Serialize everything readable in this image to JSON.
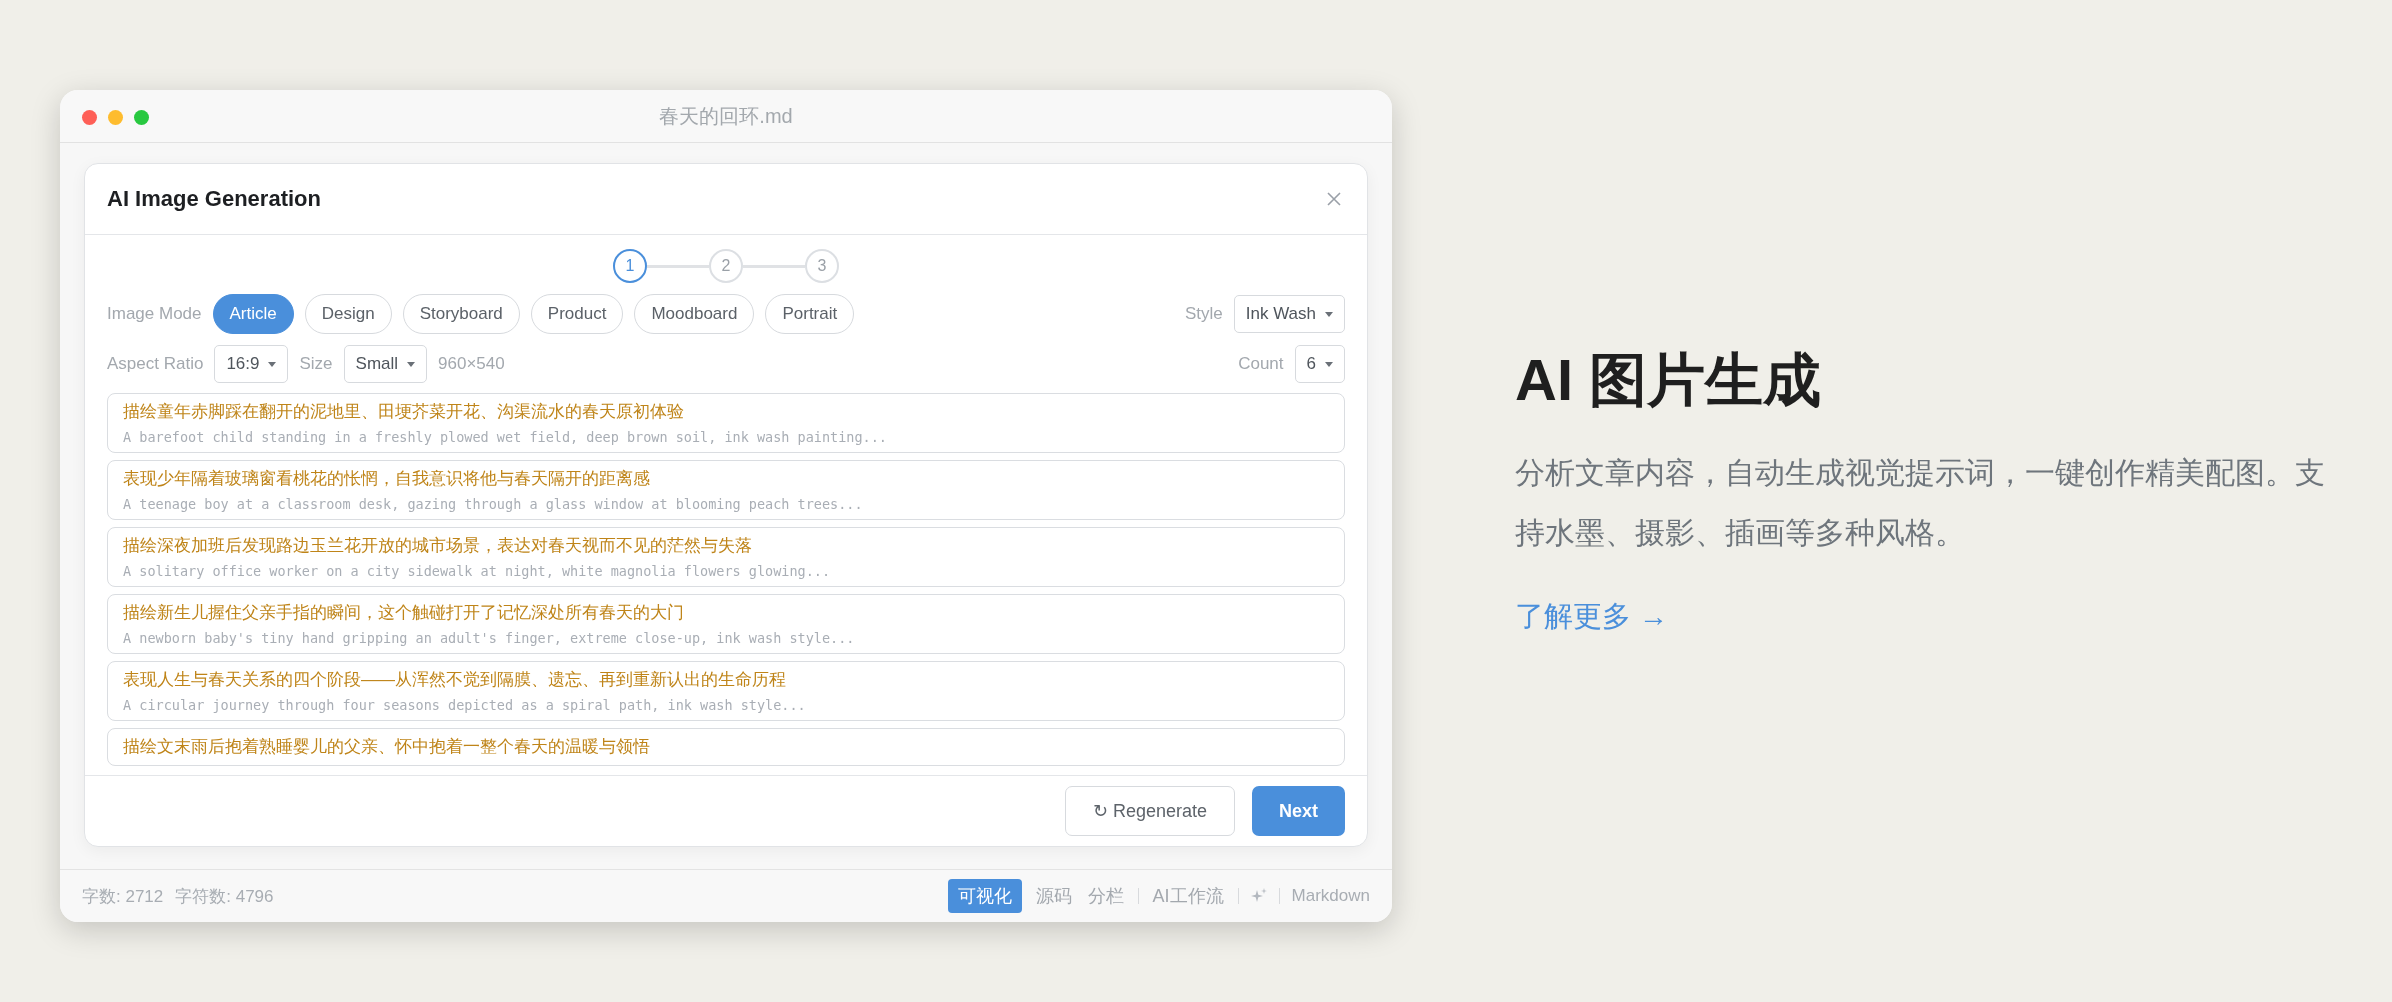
{
  "window": {
    "title": "春天的回环.md"
  },
  "dialog": {
    "title": "AI Image Generation",
    "steps": [
      {
        "label": "1",
        "selected": true
      },
      {
        "label": "2",
        "selected": false
      },
      {
        "label": "3",
        "selected": false
      }
    ],
    "image_mode": {
      "label": "Image Mode",
      "options": [
        {
          "label": "Article",
          "selected": true
        },
        {
          "label": "Design",
          "selected": false
        },
        {
          "label": "Storyboard",
          "selected": false
        },
        {
          "label": "Product",
          "selected": false
        },
        {
          "label": "Moodboard",
          "selected": false
        },
        {
          "label": "Portrait",
          "selected": false
        }
      ]
    },
    "style": {
      "label": "Style",
      "value": "Ink Wash"
    },
    "aspect_ratio": {
      "label": "Aspect Ratio",
      "value": "16:9"
    },
    "size": {
      "label": "Size",
      "value": "Small",
      "resolution": "960×540"
    },
    "count": {
      "label": "Count",
      "value": "6"
    },
    "prompts": [
      {
        "title": "描绘童年赤脚踩在翻开的泥地里、田埂芥菜开花、沟渠流水的春天原初体验",
        "description": "A barefoot child standing in a freshly plowed wet field, deep brown soil, ink wash painting..."
      },
      {
        "title": "表现少年隔着玻璃窗看桃花的怅惘，自我意识将他与春天隔开的距离感",
        "description": "A teenage boy at a classroom desk, gazing through a glass window at blooming peach trees..."
      },
      {
        "title": "描绘深夜加班后发现路边玉兰花开放的城市场景，表达对春天视而不见的茫然与失落",
        "description": "A solitary office worker on a city sidewalk at night, white magnolia flowers glowing..."
      },
      {
        "title": "描绘新生儿握住父亲手指的瞬间，这个触碰打开了记忆深处所有春天的大门",
        "description": "A newborn baby's tiny hand gripping an adult's finger, extreme close-up, ink wash style..."
      },
      {
        "title": "表现人生与春天关系的四个阶段——从浑然不觉到隔膜、遗忘、再到重新认出的生命历程",
        "description": "A circular journey through four seasons depicted as a spiral path, ink wash style..."
      },
      {
        "title": "描绘文末雨后抱着熟睡婴儿的父亲、怀中抱着一整个春天的温暖与领悟"
      }
    ],
    "buttons": [
      {
        "kind": "secondary",
        "label": "↻ Regenerate"
      },
      {
        "kind": "primary",
        "label": "Next"
      }
    ]
  },
  "status_bar": {
    "word_count": "字数: 2712",
    "char_count": "字符数: 4796",
    "view_modes": [
      {
        "label": "可视化",
        "selected": true
      },
      {
        "label": "源码",
        "selected": false
      },
      {
        "label": "分栏",
        "selected": false
      }
    ],
    "ai_workflow": "AI工作流",
    "format": "Markdown"
  },
  "promo": {
    "heading": "AI 图片生成",
    "description": "分析文章内容，自动生成视觉提示词，一键创作精美配图。支持水墨、摄影、插画等多种风格。",
    "link": "了解更多 →"
  }
}
